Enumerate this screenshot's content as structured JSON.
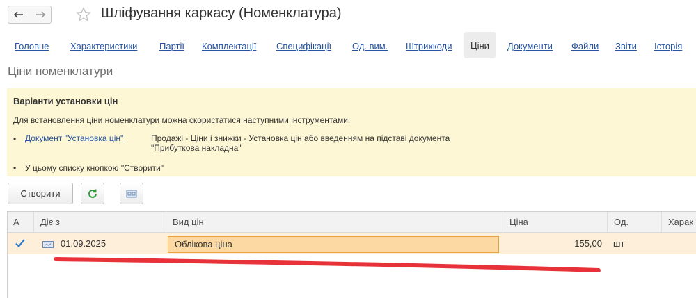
{
  "window": {
    "title": "Шліфування каркасу (Номенклатура)"
  },
  "tabs": [
    {
      "label": "Головне",
      "active": false
    },
    {
      "label": "Характеристики",
      "active": false
    },
    {
      "label": "Партії",
      "active": false
    },
    {
      "label": "Комплектації",
      "active": false
    },
    {
      "label": "Специфікації",
      "active": false
    },
    {
      "label": "Од. вим.",
      "active": false
    },
    {
      "label": "Штрихкоди",
      "active": false
    },
    {
      "label": "Ціни",
      "active": true
    },
    {
      "label": "Документи",
      "active": false
    },
    {
      "label": "Файли",
      "active": false
    },
    {
      "label": "Звіти",
      "active": false
    },
    {
      "label": "Історія",
      "active": false
    }
  ],
  "section": {
    "title": "Ціни номенклатури"
  },
  "info": {
    "heading": "Варіанти установки цін",
    "intro": "Для встановлення ціни номенклатури можна скористатися наступними інструментами:",
    "bullet_char": "•",
    "doc_link": "Документ \"Установка цін\"",
    "doc_text": "Продажі - Ціни і знижки - Установка цін або введенням на підставі документа \"Прибуткова накладна\"",
    "create_hint": "У цьому списку кнопкою \"Створити\""
  },
  "toolbar": {
    "create_label": "Створити"
  },
  "table": {
    "columns": [
      "А",
      "Діє з",
      "Вид цін",
      "Ціна",
      "Од.",
      "Харак"
    ],
    "rows": [
      {
        "date": "01.09.2025",
        "price_type": "Облікова ціна",
        "price": "155,00",
        "unit": "шт",
        "characteristic": ""
      }
    ]
  },
  "colors": {
    "link": "#2653a3",
    "info_bg": "#fdf7d5",
    "row_selected": "#fdefd9",
    "cell_edit": "#fcd9a3",
    "check": "#2f7cd3",
    "refresh": "#2e9b3e",
    "annotation": "#e8323a"
  }
}
